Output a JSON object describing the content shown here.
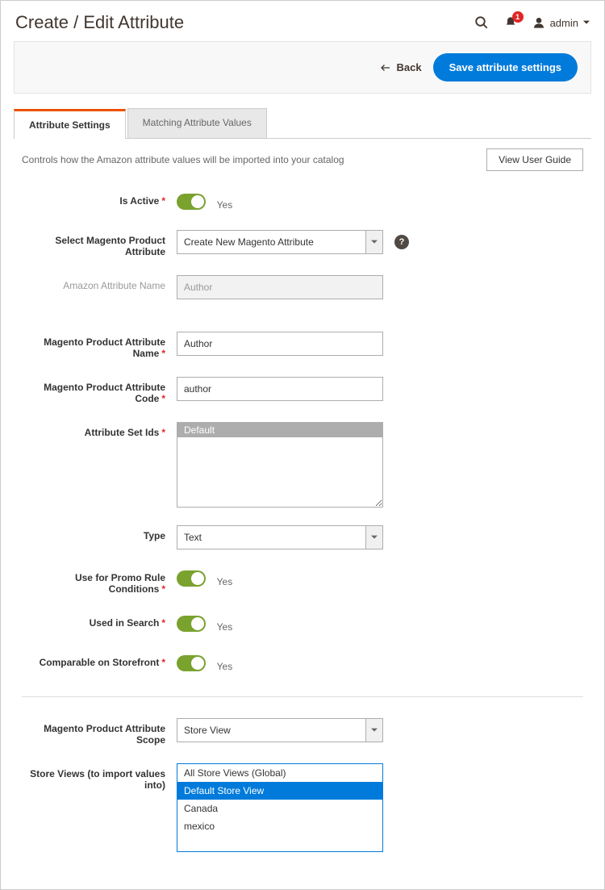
{
  "header": {
    "title": "Create / Edit Attribute",
    "notification_count": "1",
    "user_label": "admin"
  },
  "actions": {
    "back_label": "Back",
    "save_label": "Save attribute settings"
  },
  "tabs": {
    "settings": "Attribute Settings",
    "matching": "Matching Attribute Values"
  },
  "intro": {
    "description": "Controls how the Amazon attribute values will be imported into your catalog",
    "guide_btn": "View User Guide"
  },
  "form": {
    "is_active": {
      "label": "Is Active",
      "value_label": "Yes"
    },
    "select_attr": {
      "label": "Select Magento Product Attribute",
      "value": "Create New Magento Attribute"
    },
    "amazon_name": {
      "label": "Amazon Attribute Name",
      "value": "Author"
    },
    "mage_name": {
      "label": "Magento Product Attribute Name",
      "value": "Author"
    },
    "mage_code": {
      "label": "Magento Product Attribute Code",
      "value": "author"
    },
    "attr_set": {
      "label": "Attribute Set Ids",
      "options": [
        "Default"
      ],
      "selected": "Default"
    },
    "type": {
      "label": "Type",
      "value": "Text"
    },
    "promo": {
      "label": "Use for Promo Rule Conditions",
      "value_label": "Yes"
    },
    "search": {
      "label": "Used in Search",
      "value_label": "Yes"
    },
    "comparable": {
      "label": "Comparable on Storefront",
      "value_label": "Yes"
    },
    "scope": {
      "label": "Magento Product Attribute Scope",
      "value": "Store View"
    },
    "store_views": {
      "label": "Store Views (to import values into)",
      "options": [
        "All Store Views (Global)",
        "Default Store View",
        "Canada",
        "mexico"
      ],
      "selected": "Default Store View"
    }
  }
}
